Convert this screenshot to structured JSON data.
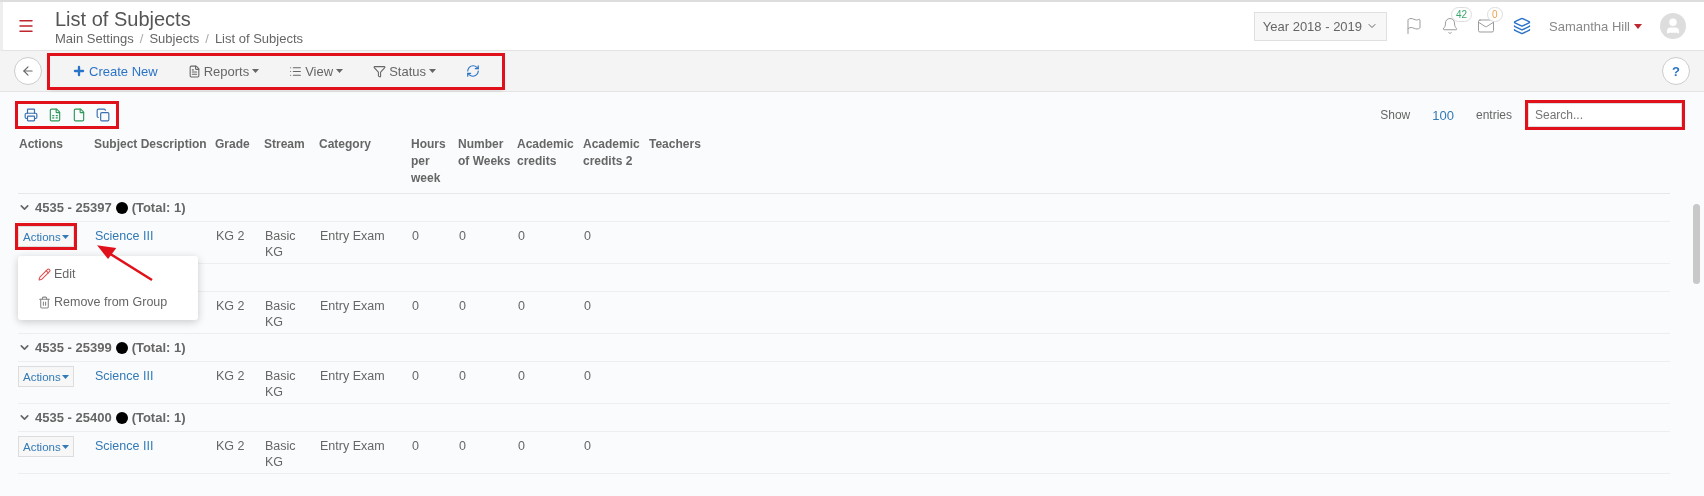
{
  "header": {
    "title": "List of Subjects",
    "breadcrumbs": [
      {
        "kind": "link",
        "text": "Main Settings"
      },
      {
        "kind": "separator",
        "text": "/"
      },
      {
        "kind": "link",
        "text": "Subjects"
      },
      {
        "kind": "separator",
        "text": "/"
      },
      {
        "kind": "link",
        "text": "List of Subjects"
      }
    ],
    "year_select": "Year 2018 - 2019",
    "notifications": "42",
    "messages": "0",
    "user": "Samantha Hill"
  },
  "toolbar": {
    "highlighted": true,
    "items": [
      {
        "kind": "create",
        "label": "Create New"
      },
      {
        "kind": "reports",
        "label": "Reports"
      },
      {
        "kind": "view",
        "label": "View"
      },
      {
        "kind": "status",
        "label": "Status"
      },
      {
        "kind": "refresh"
      }
    ],
    "help": "?"
  },
  "export": {
    "highlighted": true,
    "items": [
      {
        "kind": "print"
      },
      {
        "kind": "excel"
      },
      {
        "kind": "csv"
      },
      {
        "kind": "copy"
      }
    ]
  },
  "entries": {
    "show": "Show",
    "count": "100",
    "suffix": "entries"
  },
  "search": {
    "placeholder": "Search...",
    "highlighted": true
  },
  "columns": [
    "Actions",
    "Subject Description",
    "Grade",
    "Stream",
    "Category",
    "Hours per week",
    "Number of Weeks",
    "Academic credits",
    "Academic credits 2",
    "Teachers"
  ],
  "groups": [
    {
      "title": "4535 - 25397",
      "total": "(Total: 1)",
      "color": "#000000",
      "expanded": true,
      "rows": [
        {
          "actions": "Actions",
          "highlighted": true,
          "menu_open": true,
          "cells": [
            "Science III",
            "KG 2",
            "Basic KG",
            "Entry Exam",
            "0",
            "0",
            "0",
            "0"
          ]
        }
      ]
    },
    {
      "rows": [
        {
          "highlighted": false,
          "menu_open": false,
          "cells": [
            "KG 2",
            "Basic KG",
            "Entry Exam",
            "0",
            "0",
            "0",
            "0"
          ]
        }
      ]
    },
    {
      "title": "4535 - 25399",
      "total": "(Total: 1)",
      "color": "#000000",
      "expanded": true,
      "rows": [
        {
          "actions": "Actions",
          "highlighted": false,
          "menu_open": false,
          "cells": [
            "Science III",
            "KG 2",
            "Basic KG",
            "Entry Exam",
            "0",
            "0",
            "0",
            "0"
          ]
        }
      ]
    },
    {
      "title": "4535 - 25400",
      "total": "(Total: 1)",
      "color": "#000000",
      "expanded": true,
      "rows": [
        {
          "actions": "Actions",
          "highlighted": false,
          "menu_open": false,
          "cells": [
            "Science III",
            "KG 2",
            "Basic KG",
            "Entry Exam",
            "0",
            "0",
            "0",
            "0"
          ]
        }
      ]
    }
  ],
  "actions_menu": [
    {
      "kind": "edit",
      "label": "Edit"
    },
    {
      "kind": "remove",
      "label": "Remove from Group"
    }
  ]
}
